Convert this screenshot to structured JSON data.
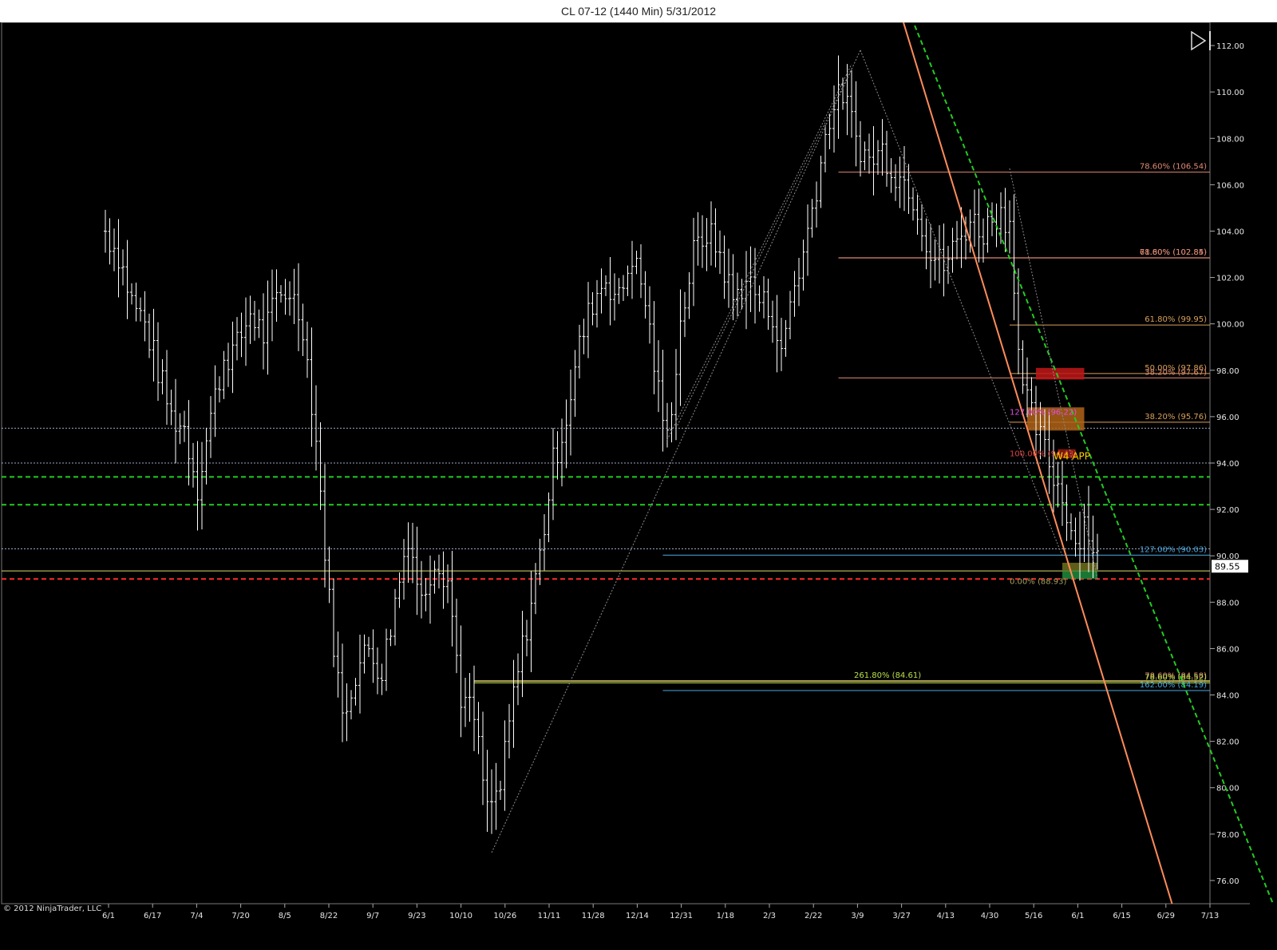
{
  "title": "CL 07-12 (1440 Min)  5/31/2012",
  "copyright": "© 2012 NinjaTrader, LLC",
  "colors": {
    "background": "#000000",
    "bars": "#ffffff",
    "price_tag_bg": "#ffffff",
    "trend_orange": "#ff8c5a",
    "trend_green": "#22cc22",
    "support_red": "#ff2a2a"
  },
  "icons": [
    "play-to-end-icon"
  ],
  "chart_data": {
    "type": "ohlc-bar",
    "ylim": [
      75,
      113
    ],
    "yticks": [
      "112.00",
      "110.00",
      "108.00",
      "106.00",
      "104.00",
      "102.00",
      "100.00",
      "98.00",
      "96.00",
      "94.00",
      "92.00",
      "90.00",
      "88.00",
      "86.00",
      "84.00",
      "82.00",
      "80.00",
      "78.00",
      "76.00"
    ],
    "xticks": [
      "6/1",
      "6/17",
      "7/4",
      "7/20",
      "8/5",
      "8/22",
      "9/7",
      "9/23",
      "10/10",
      "10/26",
      "11/11",
      "11/28",
      "12/14",
      "12/31",
      "1/18",
      "2/3",
      "2/22",
      "3/9",
      "3/27",
      "4/13",
      "4/30",
      "5/16",
      "6/1",
      "6/15",
      "6/29",
      "7/13"
    ],
    "last_price": "89.55",
    "price_path": [
      [
        0,
        104
      ],
      [
        3,
        103
      ],
      [
        6,
        101
      ],
      [
        9,
        100
      ],
      [
        12,
        98
      ],
      [
        15,
        96
      ],
      [
        18,
        95.5
      ],
      [
        21,
        93
      ],
      [
        24,
        96
      ],
      [
        27,
        98.5
      ],
      [
        30,
        99
      ],
      [
        33,
        100.5
      ],
      [
        36,
        99.5
      ],
      [
        39,
        101
      ],
      [
        42,
        101.5
      ],
      [
        45,
        100
      ],
      [
        48,
        95
      ],
      [
        51,
        88
      ],
      [
        54,
        83
      ],
      [
        57,
        85
      ],
      [
        60,
        86
      ],
      [
        63,
        85
      ],
      [
        66,
        88
      ],
      [
        69,
        91
      ],
      [
        72,
        88
      ],
      [
        75,
        90
      ],
      [
        78,
        89
      ],
      [
        81,
        84
      ],
      [
        84,
        83
      ],
      [
        87,
        79
      ],
      [
        90,
        80
      ],
      [
        93,
        84
      ],
      [
        96,
        87
      ],
      [
        99,
        90
      ],
      [
        102,
        94
      ],
      [
        105,
        96
      ],
      [
        108,
        99
      ],
      [
        111,
        101
      ],
      [
        114,
        102
      ],
      [
        117,
        101
      ],
      [
        120,
        103
      ],
      [
        123,
        101
      ],
      [
        126,
        97
      ],
      [
        128,
        95
      ],
      [
        131,
        100
      ],
      [
        134,
        103
      ],
      [
        137,
        104
      ],
      [
        140,
        103
      ],
      [
        143,
        101
      ],
      [
        146,
        102
      ],
      [
        149,
        101
      ],
      [
        152,
        100.5
      ],
      [
        154,
        98.5
      ],
      [
        156,
        101
      ],
      [
        159,
        103
      ],
      [
        162,
        106
      ],
      [
        165,
        109
      ],
      [
        168,
        110
      ],
      [
        171,
        108
      ],
      [
        174,
        107
      ],
      [
        177,
        107.5
      ],
      [
        180,
        106.5
      ],
      [
        183,
        106
      ],
      [
        185,
        105
      ],
      [
        188,
        103
      ],
      [
        191,
        102.5
      ],
      [
        194,
        103.5
      ],
      [
        197,
        104.5
      ],
      [
        200,
        104
      ],
      [
        203,
        104.8
      ],
      [
        206,
        104.5
      ],
      [
        207,
        102
      ],
      [
        208,
        99
      ],
      [
        209,
        97
      ],
      [
        211,
        96
      ],
      [
        213,
        95
      ],
      [
        215,
        94
      ],
      [
        217,
        93
      ],
      [
        219,
        92
      ],
      [
        221,
        90.5
      ],
      [
        223,
        91.5
      ],
      [
        225,
        90.5
      ],
      [
        227,
        89.55
      ]
    ],
    "hlines": [
      {
        "price": 95.5,
        "color": "#9aa8c0",
        "style": "dotted"
      },
      {
        "price": 94.0,
        "color": "#9aa8c0",
        "style": "dotted"
      },
      {
        "price": 90.3,
        "color": "#9aa8c0",
        "style": "dotted"
      },
      {
        "price": 93.4,
        "color": "#22cc22",
        "style": "dashed"
      },
      {
        "price": 92.2,
        "color": "#22cc22",
        "style": "dashed"
      },
      {
        "price": 89.0,
        "color": "#ff2a2a",
        "style": "dashed"
      },
      {
        "price": 89.35,
        "color": "#dddd66",
        "style": "solid"
      }
    ],
    "fib_levels": [
      {
        "label": "78.60% (106.54)",
        "price": 106.54,
        "color": "#e08a72",
        "x0": 167
      },
      {
        "label": "78.60% (102.84)",
        "price": 102.84,
        "color": "#e08a72",
        "x0": 167
      },
      {
        "label": "61.80% (102.85)",
        "price": 102.85,
        "color": "#e08a72",
        "x0": 167
      },
      {
        "label": "61.80% (99.95)",
        "price": 99.95,
        "color": "#d9a15a",
        "x0": 206
      },
      {
        "label": "50.00% (97.86)",
        "price": 97.86,
        "color": "#d9a15a",
        "x0": 206
      },
      {
        "label": "38.20% (97.67)",
        "price": 97.67,
        "color": "#e08a72",
        "x0": 167
      },
      {
        "label": "38.20% (95.76)",
        "price": 95.76,
        "color": "#d9a15a",
        "x0": 206
      },
      {
        "label": "127.00% (90.03)",
        "price": 90.03,
        "color": "#4aa8e0",
        "x0": 127
      },
      {
        "label": "78.60% (84.58)",
        "price": 84.58,
        "color": "#e08a72",
        "x0": 84
      },
      {
        "label": "261.80% (84.61)",
        "price": 84.61,
        "color": "#b8e04a",
        "x0": 84
      },
      {
        "label": "78.60% (84.52)",
        "price": 84.52,
        "color": "#b8e04a",
        "x0": 84
      },
      {
        "label": "162.00% (84.19)",
        "price": 84.19,
        "color": "#4aa8e0",
        "x0": 127
      }
    ],
    "annotations": [
      {
        "label": "127.00% (96.22)",
        "price": 96.22,
        "bar": 206,
        "color": "#e050e0"
      },
      {
        "label": "100.00% (94.43)",
        "price": 94.43,
        "bar": 206,
        "color": "#e04040"
      },
      {
        "label": "W4 APP",
        "price": 94.3,
        "bar": 216,
        "color": "#ffd200"
      },
      {
        "label": "0.00% (88.93)",
        "price": 88.93,
        "bar": 206,
        "color": "#a0a060"
      }
    ],
    "zones": [
      {
        "bar0": 212,
        "bar1": 223,
        "p0": 97.6,
        "p1": 98.1,
        "color": "#c01818"
      },
      {
        "bar0": 210,
        "bar1": 223,
        "p0": 95.4,
        "p1": 96.4,
        "color": "#b06418"
      },
      {
        "bar0": 217,
        "bar1": 221,
        "p0": 94.2,
        "p1": 94.6,
        "color": "#8a1c10"
      },
      {
        "bar0": 218,
        "bar1": 226,
        "p0": 89.0,
        "p1": 89.35,
        "color": "#1e8c3c"
      },
      {
        "bar0": 218,
        "bar1": 226,
        "p0": 89.35,
        "p1": 89.7,
        "color": "#6e6e1c"
      }
    ],
    "trendlines": [
      {
        "b0": 181,
        "p0": 113.5,
        "b1": 243,
        "p1": 75.0,
        "color": "#ff8c5a",
        "style": "solid"
      },
      {
        "b0": 183,
        "p0": 113.5,
        "b1": 266,
        "p1": 75.0,
        "color": "#22cc22",
        "style": "dashed"
      },
      {
        "b0": 88,
        "p0": 77.2,
        "b1": 172,
        "p1": 111.8,
        "color": "#8c8c8c",
        "style": "dotted"
      },
      {
        "b0": 128,
        "p0": 95,
        "b1": 170,
        "p1": 111.2,
        "color": "#8c8c8c",
        "style": "dotted"
      },
      {
        "b0": 130,
        "p0": 95.5,
        "b1": 170,
        "p1": 111.0,
        "color": "#8c8c8c",
        "style": "dotted"
      },
      {
        "b0": 172,
        "p0": 111.8,
        "b1": 218,
        "p1": 90.0,
        "color": "#8c8c8c",
        "style": "dotted"
      },
      {
        "b0": 206,
        "p0": 106.7,
        "b1": 226,
        "p1": 89.0,
        "color": "#8c8c8c",
        "style": "dotted"
      }
    ]
  }
}
